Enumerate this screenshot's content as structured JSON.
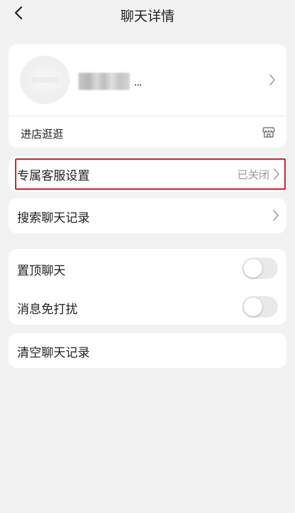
{
  "header": {
    "title": "聊天详情",
    "back_icon": "chevron-left-icon"
  },
  "shop": {
    "name_suffix": "...",
    "visit_label": "进店逛逛",
    "visit_icon": "store-icon"
  },
  "service": {
    "label": "专属客服设置",
    "value": "已关闭",
    "highlight_color": "#e02020"
  },
  "search": {
    "label": "搜索聊天记录"
  },
  "toggles": [
    {
      "label": "置顶聊天",
      "on": false
    },
    {
      "label": "消息免打扰",
      "on": false
    }
  ],
  "clear": {
    "label": "清空聊天记录"
  }
}
